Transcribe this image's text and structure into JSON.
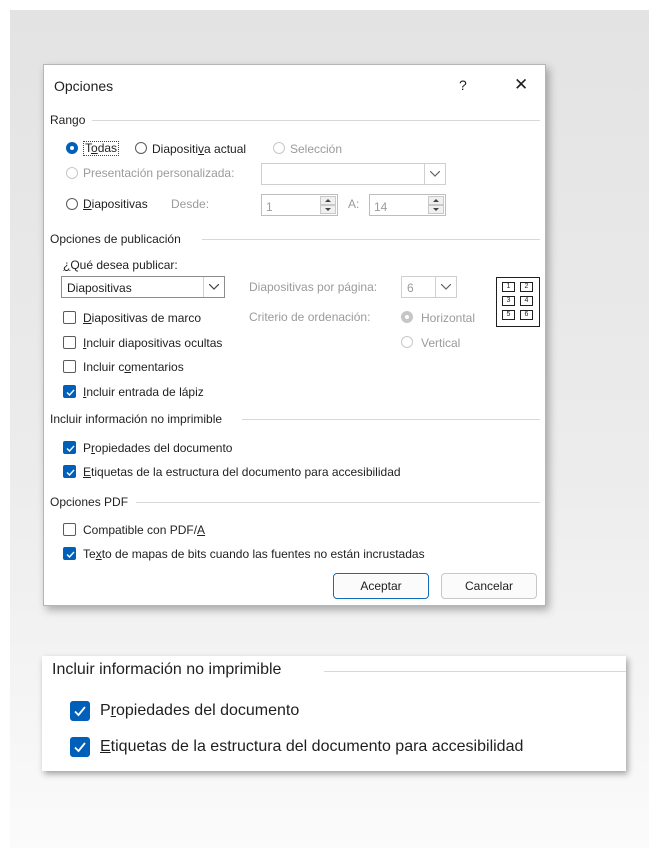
{
  "dialog": {
    "title": "Opciones",
    "help_label": "?",
    "close_label": "✕",
    "range": {
      "section_label": "Rango",
      "all_label": "Todas",
      "current_label": "Diapositiva actual",
      "selection_label": "Selección",
      "custom_show_label": "Presentación personalizada:",
      "custom_show_value": "",
      "slides_label": "Diapositivas",
      "from_label": "Desde:",
      "from_value": "1",
      "to_label": "A:",
      "to_value": "14",
      "selected": "Todas"
    },
    "publish": {
      "section_label": "Opciones de publicación",
      "what_label": "¿Qué desea publicar:",
      "what_value": "Diapositivas",
      "per_page_label": "Diapositivas por página:",
      "per_page_value": "6",
      "order_label": "Criterio de ordenación:",
      "horizontal_label": "Horizontal",
      "vertical_label": "Vertical",
      "layout_cells": [
        "1",
        "2",
        "3",
        "4",
        "5",
        "6"
      ],
      "frame_label": "Diapositivas de marco",
      "frame_checked": false,
      "hidden_label": "Incluir diapositivas ocultas",
      "hidden_checked": false,
      "comments_label": "Incluir comentarios",
      "comments_checked": false,
      "ink_label": "Incluir entrada de lápiz",
      "ink_checked": true
    },
    "nonprint": {
      "section_label": "Incluir información no imprimible",
      "props_label": "Propiedades del documento",
      "props_checked": true,
      "tags_label": "Etiquetas de la estructura del documento para accesibilidad",
      "tags_checked": true
    },
    "pdf": {
      "section_label": "Opciones PDF",
      "pdfa_label": "Compatible con PDF/A",
      "pdfa_checked": false,
      "bitmap_label": "Texto de mapas de bits cuando las fuentes no están incrustadas",
      "bitmap_checked": true
    },
    "ok_label": "Aceptar",
    "cancel_label": "Cancelar"
  },
  "zoom": {
    "section_label": "Incluir información no imprimible",
    "props_label": "Propiedades del documento",
    "tags_label": "Etiquetas de la estructura del documento para accesibilidad"
  },
  "colors": {
    "accent": "#005fb8",
    "disabled_text": "#9b9b9b"
  }
}
